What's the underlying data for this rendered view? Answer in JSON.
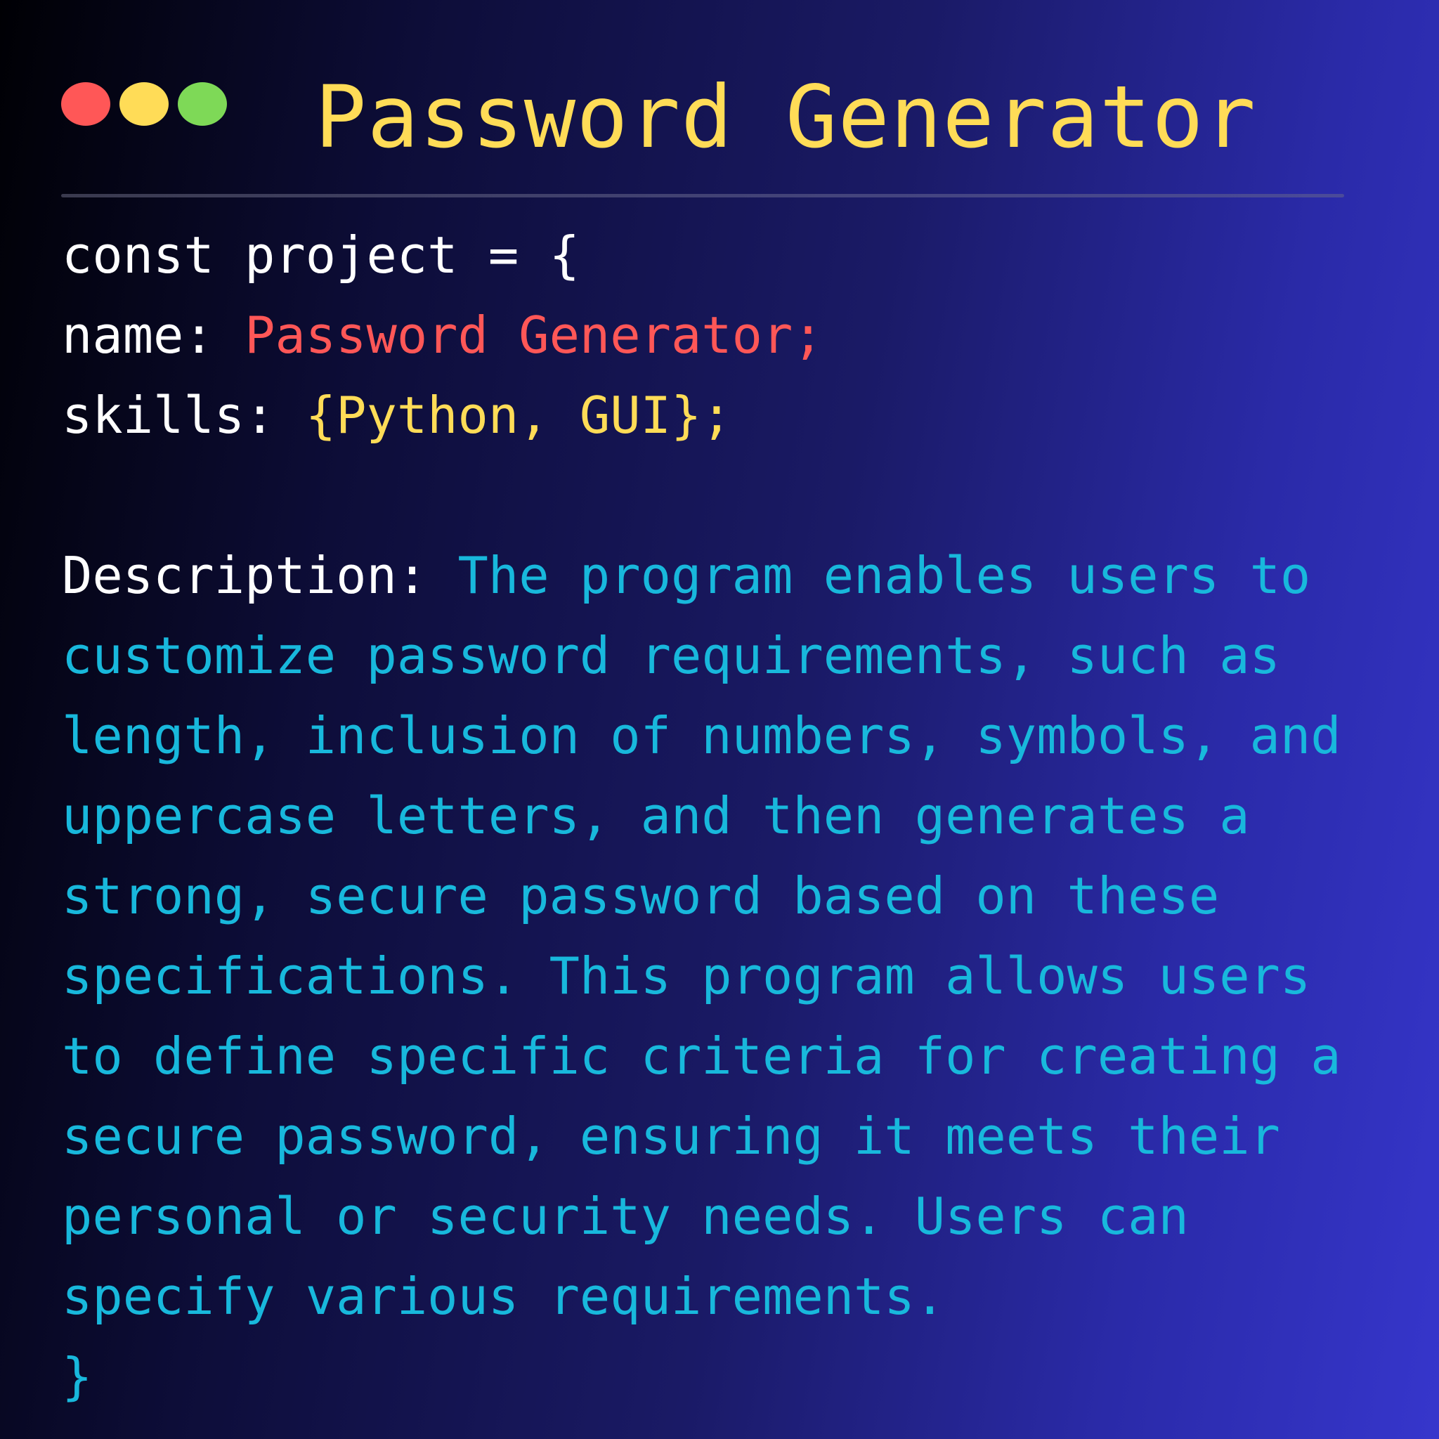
{
  "window_controls": {
    "close_color": "#ff5757",
    "minimize_color": "#ffdc57",
    "maximize_color": "#7ed957"
  },
  "title": "Password Generator",
  "colors": {
    "title": "#ffdc57",
    "key": "#ffffff",
    "name_value": "#ff5757",
    "skills_value": "#ffdc57",
    "description": "#18b8dc"
  },
  "code": {
    "open": "const project = {",
    "name_key": "name: ",
    "name_value": "Password Generator;",
    "skills_key": "skills: ",
    "skills_value": "{Python, GUI};",
    "description_key": "Description: ",
    "description_lines": [
      "The program enables users to",
      "customize password requirements, such as",
      "length, inclusion of numbers, symbols, and",
      "uppercase letters, and then generates a",
      "strong, secure password based on these",
      "specifications. This program allows users",
      "to define specific criteria for creating a",
      "secure password, ensuring it meets their",
      "personal or security needs. Users can",
      "specify various requirements."
    ],
    "close": "}"
  }
}
